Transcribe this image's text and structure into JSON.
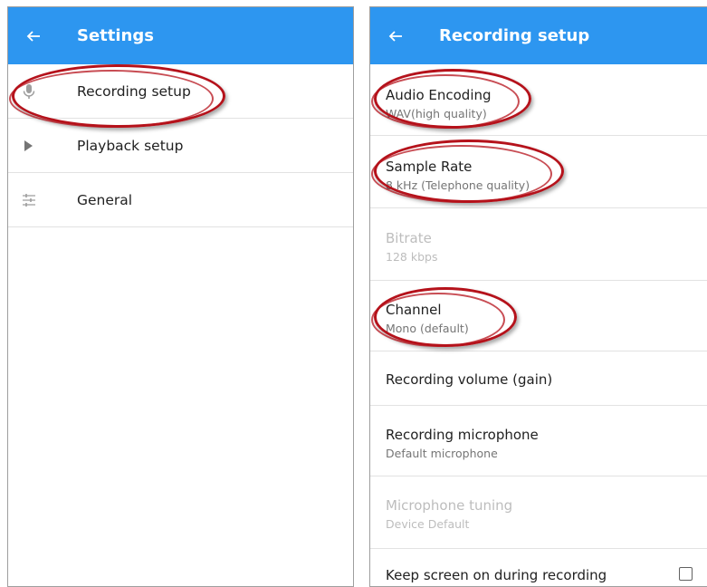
{
  "colors": {
    "appbar": "#2d96f0",
    "annotation": "#b5121b"
  },
  "settings_screen": {
    "title": "Settings",
    "back_icon": "arrow-left-icon",
    "items": [
      {
        "label": "Recording setup",
        "icon": "microphone-icon"
      },
      {
        "label": "Playback setup",
        "icon": "play-icon"
      },
      {
        "label": "General",
        "icon": "sliders-icon"
      }
    ]
  },
  "recording_screen": {
    "title": "Recording setup",
    "back_icon": "arrow-left-icon",
    "prefs": [
      {
        "title": "Audio Encoding",
        "summary": "WAV(high quality)",
        "enabled": true
      },
      {
        "title": "Sample Rate",
        "summary": "8 kHz (Telephone quality)",
        "enabled": true
      },
      {
        "title": "Bitrate",
        "summary": "128 kbps",
        "enabled": false
      },
      {
        "title": "Channel",
        "summary": "Mono (default)",
        "enabled": true
      },
      {
        "title": "Recording volume (gain)",
        "summary": "",
        "enabled": true
      },
      {
        "title": "Recording microphone",
        "summary": "Default microphone",
        "enabled": true
      },
      {
        "title": "Microphone tuning",
        "summary": "Device Default",
        "enabled": false
      },
      {
        "title": "Keep screen on during recording",
        "summary": "",
        "enabled": true,
        "checked": false
      }
    ]
  }
}
